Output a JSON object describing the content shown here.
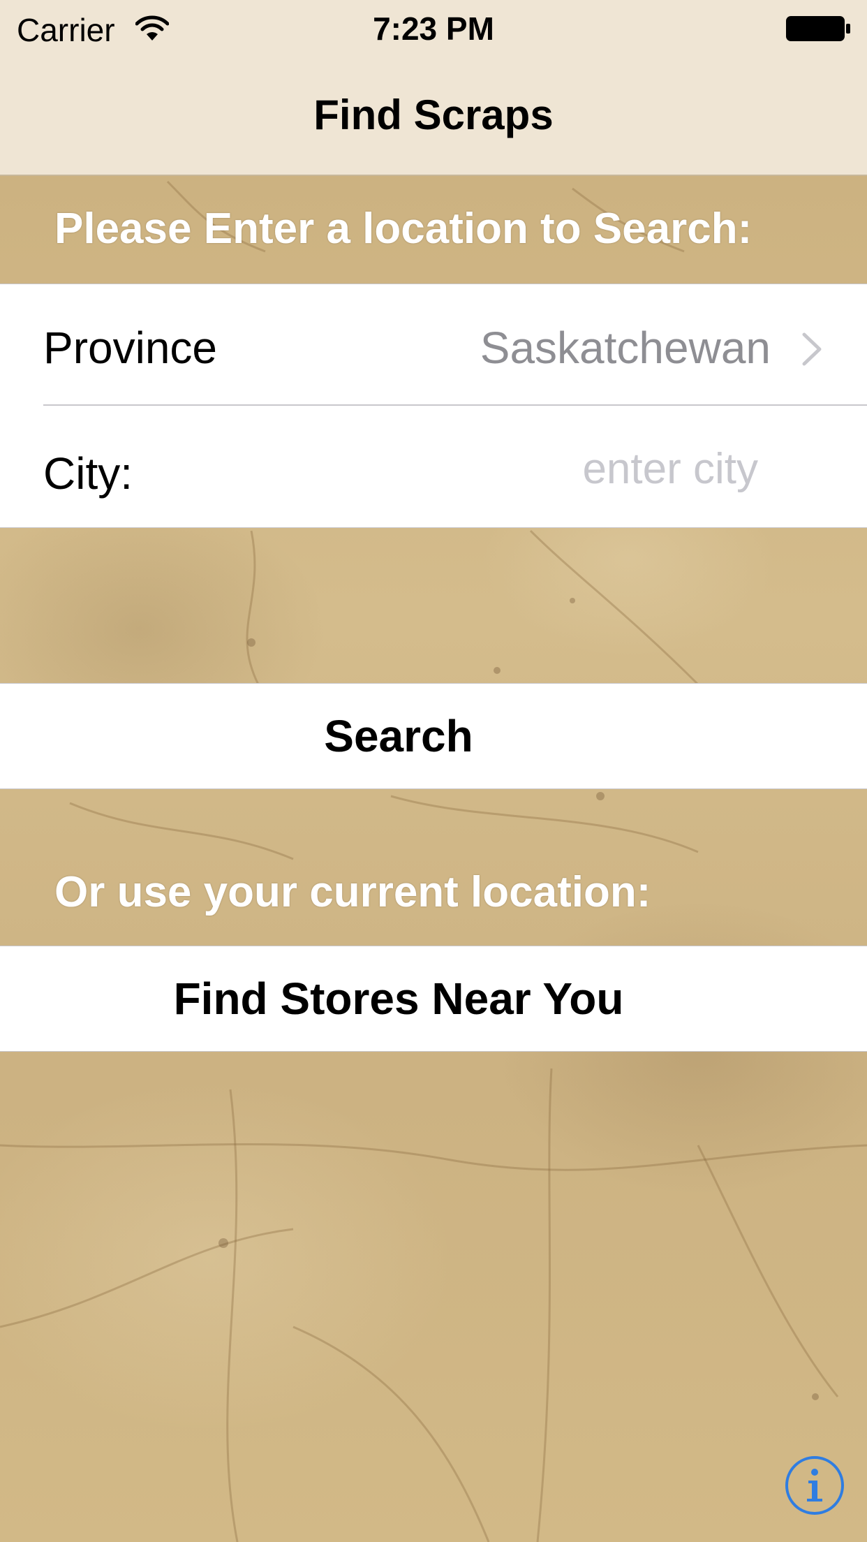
{
  "status_bar": {
    "carrier": "Carrier",
    "time": "7:23 PM",
    "wifi_icon": "wifi-icon",
    "battery_icon": "battery-full-icon"
  },
  "nav": {
    "title": "Find Scraps"
  },
  "search_section": {
    "header": "Please Enter a location to Search:",
    "province_label": "Province",
    "province_value": "Saskatchewan",
    "city_label": "City:",
    "city_value": "",
    "city_placeholder": "enter city",
    "search_button": "Search"
  },
  "location_section": {
    "header": "Or use your current location:",
    "find_button": "Find Stores Near You"
  },
  "info_icon": "info-icon",
  "colors": {
    "nav_background": "#efe5d4",
    "parchment": "#cdb383",
    "tint_blue": "#2f7de1",
    "value_gray": "#8e8e93",
    "placeholder_gray": "#c7c7cd"
  }
}
